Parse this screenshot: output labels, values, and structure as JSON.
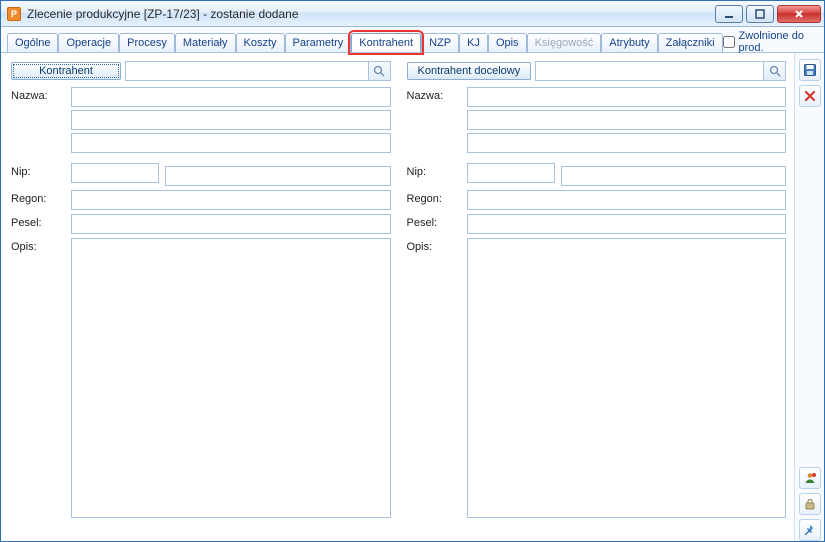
{
  "window": {
    "title": "Zlecenie produkcyjne  [ZP-17/23] - zostanie dodane"
  },
  "tabs": [
    {
      "label": "Ogólne",
      "disabled": false
    },
    {
      "label": "Operacje",
      "disabled": false
    },
    {
      "label": "Procesy",
      "disabled": false
    },
    {
      "label": "Materiały",
      "disabled": false
    },
    {
      "label": "Koszty",
      "disabled": false
    },
    {
      "label": "Parametry",
      "disabled": false
    },
    {
      "label": "Kontrahent",
      "active": true
    },
    {
      "label": "NZP",
      "disabled": false
    },
    {
      "label": "KJ",
      "disabled": false
    },
    {
      "label": "Opis",
      "disabled": false
    },
    {
      "label": "Księgowość",
      "disabled": true
    },
    {
      "label": "Atrybuty",
      "disabled": false
    },
    {
      "label": "Załączniki",
      "disabled": false
    }
  ],
  "release_checkbox": {
    "label": "Zwolnione do prod.",
    "checked": false
  },
  "left": {
    "header_button": "Kontrahent",
    "lookup_value": "",
    "labels": {
      "nazwa": "Nazwa:",
      "nip": "Nip:",
      "regon": "Regon:",
      "pesel": "Pesel:",
      "opis": "Opis:"
    },
    "nazwa1": "",
    "nazwa2": "",
    "nazwa3": "",
    "nip_prefix": "",
    "nip": "",
    "regon": "",
    "pesel": "",
    "opis": ""
  },
  "right": {
    "header_button": "Kontrahent docelowy",
    "lookup_value": "",
    "labels": {
      "nazwa": "Nazwa:",
      "nip": "Nip:",
      "regon": "Regon:",
      "pesel": "Pesel:",
      "opis": "Opis:"
    },
    "nazwa1": "",
    "nazwa2": "",
    "nazwa3": "",
    "nip_prefix": "",
    "nip": "",
    "regon": "",
    "pesel": "",
    "opis": ""
  },
  "icons": {
    "app": "P",
    "save": "save",
    "delete": "delete",
    "assign": "assign",
    "lock": "lock",
    "pin": "pin"
  }
}
